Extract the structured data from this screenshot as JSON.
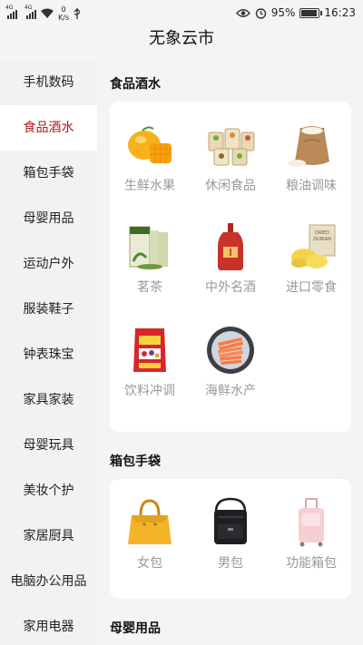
{
  "status_bar": {
    "sim1_type": "4G",
    "sim2_type": "4G",
    "net_speed": "0",
    "net_speed_unit": "K/s",
    "battery": "95%",
    "battery_level": 0.95,
    "time": "16:23"
  },
  "app": {
    "title": "无象云市"
  },
  "sidebar": {
    "items": [
      {
        "label": "手机数码"
      },
      {
        "label": "食品酒水",
        "active": true
      },
      {
        "label": "箱包手袋"
      },
      {
        "label": "母婴用品"
      },
      {
        "label": "运动户外"
      },
      {
        "label": "服装鞋子"
      },
      {
        "label": "钟表珠宝"
      },
      {
        "label": "家具家装"
      },
      {
        "label": "母婴玩具"
      },
      {
        "label": "美妆个护"
      },
      {
        "label": "家居厨具"
      },
      {
        "label": "电脑办公用品"
      },
      {
        "label": "家用电器"
      }
    ]
  },
  "sections": [
    {
      "title": "食品酒水",
      "items": [
        {
          "label": "生鲜水果",
          "icon": "mango-image"
        },
        {
          "label": "休闲食品",
          "icon": "snack-bags-image"
        },
        {
          "label": "粮油调味",
          "icon": "rice-sack-image"
        },
        {
          "label": "茗茶",
          "icon": "tea-box-image"
        },
        {
          "label": "中外名酒",
          "icon": "liquor-bottle-image"
        },
        {
          "label": "进口零食",
          "icon": "durian-snack-image"
        },
        {
          "label": "饮料冲调",
          "icon": "cereal-bag-image"
        },
        {
          "label": "海鲜水产",
          "icon": "salmon-plate-image"
        }
      ],
      "image_text": {
        "durian_label": "DRIED DURIAN"
      }
    },
    {
      "title": "箱包手袋",
      "items": [
        {
          "label": "女包",
          "icon": "handbag-image"
        },
        {
          "label": "男包",
          "icon": "shoulder-bag-image"
        },
        {
          "label": "功能箱包",
          "icon": "suitcase-image"
        }
      ]
    },
    {
      "title": "母婴用品",
      "items": []
    }
  ],
  "colors": {
    "accent": "#b0191e",
    "label_gray": "#999999",
    "sidebar_bg": "#f2f2f2"
  }
}
